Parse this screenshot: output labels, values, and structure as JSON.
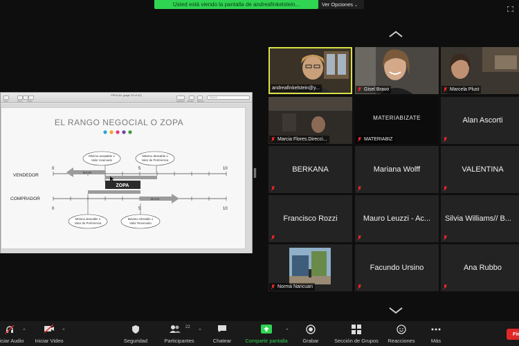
{
  "banner": {
    "viewing_text": "Usted está viendo la pantalla de andreafinkelstein...",
    "view_options": "Ver Opciones"
  },
  "shared_window": {
    "title": "PROCAL (page 19 of 32)",
    "toolbar_labels": [
      "View",
      "Zoom",
      "Share"
    ],
    "toolbar_right_labels": [
      "Highlight",
      "Rotate",
      "Markup"
    ],
    "search_placeholder": "Search"
  },
  "slide": {
    "title": "EL RANGO NEGOCIAL O ZOPA",
    "dot_colors": [
      "#2ea3d6",
      "#f0a32a",
      "#e23b7a",
      "#7b3fa0",
      "#3a9a3c"
    ],
    "vendedor_label": "VENDEDOR",
    "comprador_label": "COMPRADOR",
    "scale_min": "0",
    "scale_mid": "5",
    "scale_max": "10",
    "maan_label": "MAAN",
    "zopa_label": "ZOPA",
    "bubble_top_left": [
      "Mínimo aceptable o",
      "Valor reservado"
    ],
    "bubble_top_right": [
      "Máximo deseable o",
      "Valor de Preferencia"
    ],
    "bubble_bottom_left": [
      "Mínimo deseable o",
      "Valor de Preferencia"
    ],
    "bubble_bottom_right": [
      "Máximo ofertable o",
      "Valor Reservado"
    ]
  },
  "participants": [
    {
      "name": "andreafinkelstein@y...",
      "type": "video",
      "active": true
    },
    {
      "name": "Gisel Bravo",
      "type": "video",
      "muted": true
    },
    {
      "name": "Marcela Plust",
      "type": "video",
      "muted": true
    },
    {
      "name": "Marcia Flores.Direcci...",
      "type": "video",
      "muted": true
    },
    {
      "name": "MATERIABIZ",
      "type": "logo",
      "muted": true,
      "logo_text": "MATERIABIZATE"
    },
    {
      "name": "Alan Ascorti",
      "type": "name",
      "muted": true
    },
    {
      "name": "BERKANA",
      "type": "name",
      "muted": true
    },
    {
      "name": "Mariana Wolff",
      "type": "name",
      "muted": true
    },
    {
      "name": "VALENTINA",
      "type": "name",
      "muted": true
    },
    {
      "name": "Francisco Rozzi",
      "type": "name",
      "muted": true
    },
    {
      "name": "Mauro Leuzzi - Ac...",
      "type": "name",
      "muted": true
    },
    {
      "name": "Silvia Williams// B...",
      "type": "name",
      "muted": true
    },
    {
      "name": "Norma Nancuan",
      "type": "photo",
      "muted": true
    },
    {
      "name": "Facundo Ursino",
      "type": "name",
      "muted": true
    },
    {
      "name": "Ana Rubbo",
      "type": "name",
      "muted": true
    }
  ],
  "toolbar": {
    "audio": "Iniciar Audio",
    "video": "Iniciar Video",
    "security": "Seguridad",
    "participants": "Participantes",
    "participants_count": "22",
    "chat": "Chatear",
    "share": "Compartir pantalla",
    "record": "Grabar",
    "rooms": "Sección de Grupos",
    "reactions": "Reacciones",
    "more": "Más",
    "end": "Fin"
  },
  "colors": {
    "share_green": "#2fd452",
    "active_speaker": "#d8e24a",
    "muted_red": "#e02828",
    "end_red": "#e02828"
  }
}
